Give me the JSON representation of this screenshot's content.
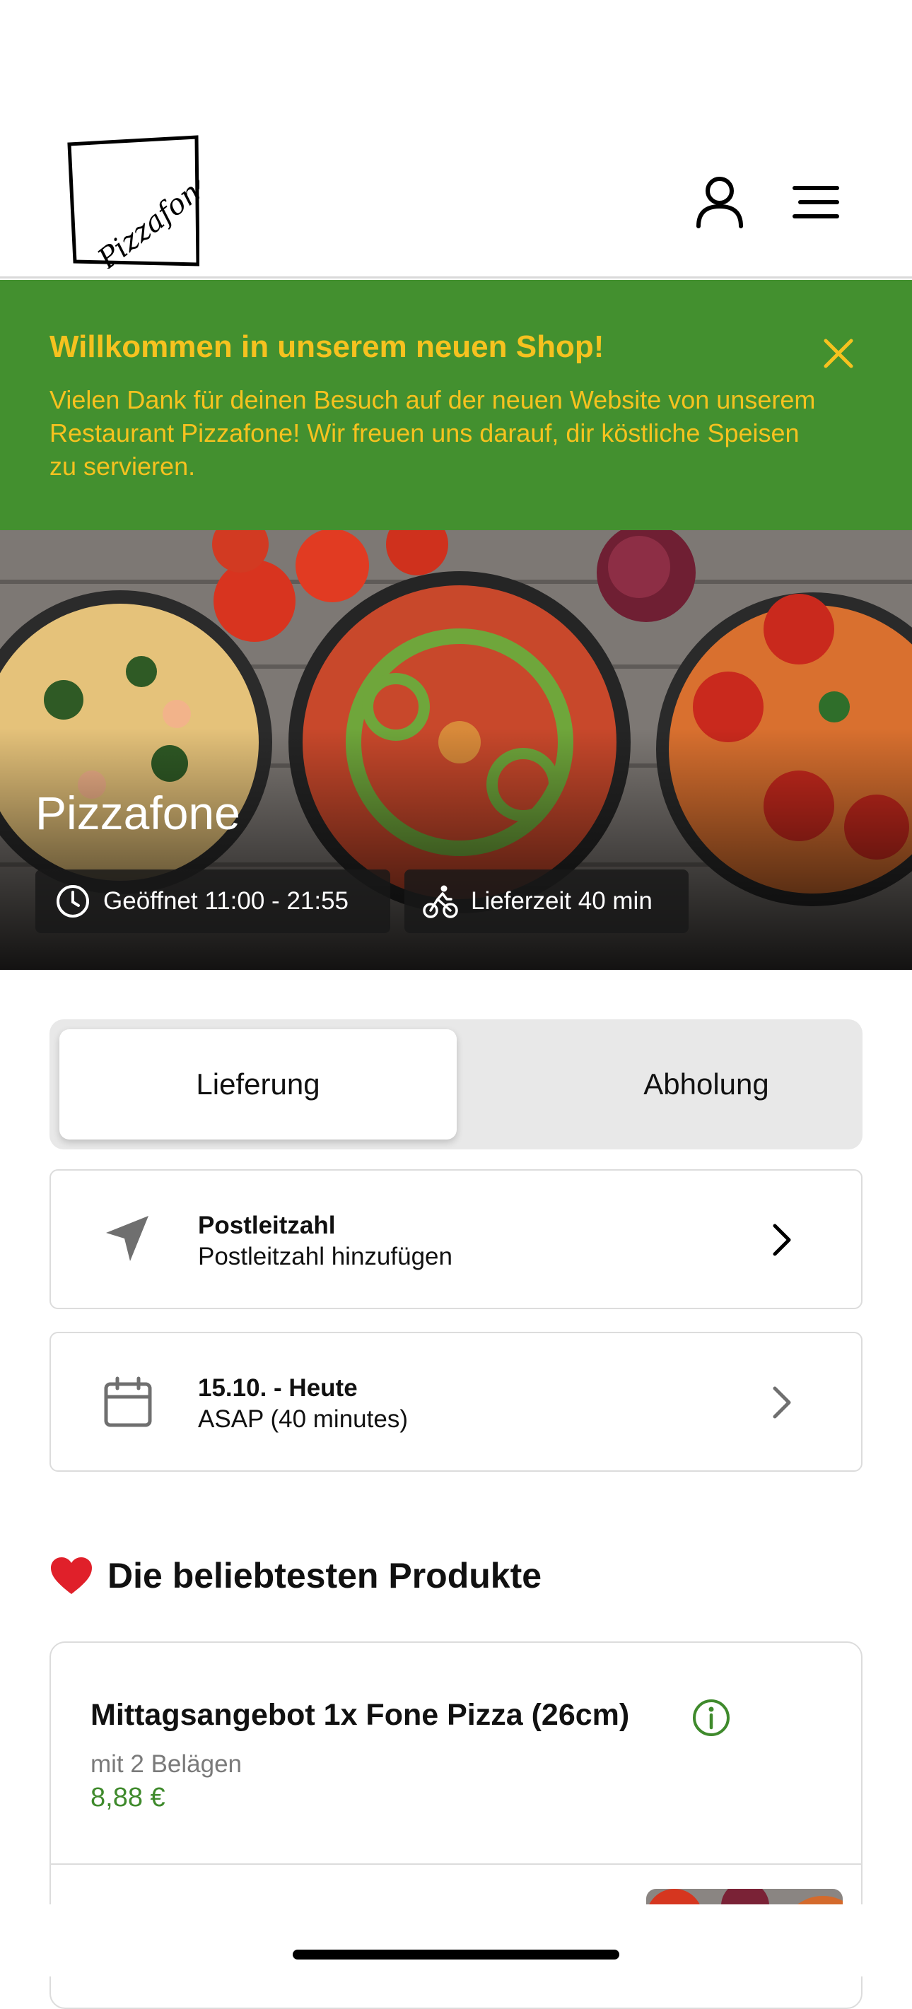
{
  "brand": {
    "logo_text": "Pizzafone"
  },
  "banner": {
    "title": "Willkommen in unserem neuen Shop!",
    "text": "Vielen Dank für deinen Besuch auf der neuen Website von unserem Restaurant Pizzafone! Wir freuen uns darauf, dir köstliche Speisen zu servieren."
  },
  "hero": {
    "title": "Pizzafone",
    "hours": "Geöffnet 11:00 - 21:55",
    "delivery_time": "Lieferzeit 40 min"
  },
  "tabs": {
    "delivery": "Lieferung",
    "pickup": "Abholung"
  },
  "postcode_card": {
    "title": "Postleitzahl",
    "subtitle": "Postleitzahl hinzufügen"
  },
  "date_card": {
    "title": "15.10. - Heute",
    "subtitle": "ASAP (40 minutes)"
  },
  "section": {
    "title": "Die beliebtesten Produkte"
  },
  "product": {
    "name": "Mittagsangebot 1x Fone Pizza (26cm)",
    "description": "mit 2 Belägen",
    "price": "8,88 €"
  },
  "colors": {
    "banner_bg": "#43902f",
    "banner_text": "#f6c21f",
    "price": "#3f8a2c"
  }
}
